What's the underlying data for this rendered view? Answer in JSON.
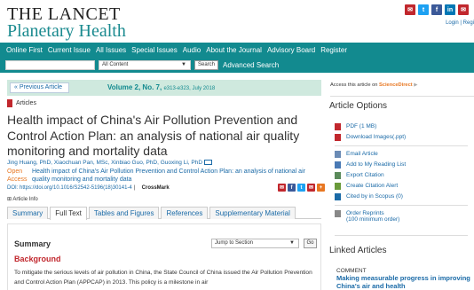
{
  "header": {
    "logo_line1": "THE LANCET",
    "logo_line2": "Planetary Health",
    "social_icons": [
      "email-icon",
      "twitter-icon",
      "facebook-icon",
      "linkedin-icon",
      "mail-icon"
    ],
    "top_links": "Login | Regi"
  },
  "nav": {
    "items": [
      "Online First",
      "Current Issue",
      "All Issues",
      "Special Issues",
      "Audio",
      "About the Journal",
      "Advisory Board",
      "Register"
    ]
  },
  "search": {
    "input_value": "",
    "content_select": "All Content",
    "search_button": "Search",
    "advanced_link": "Advanced Search"
  },
  "issue": {
    "previous_article": "« Previous Article",
    "volume": "Volume 2, No. 7,",
    "volume_detail": "e313-e323, July 2018"
  },
  "article": {
    "section_label": "Articles",
    "title": "Health impact of China's Air Pollution Prevention and Control Action Plan: an analysis of national air quality monitoring and mortality data",
    "authors": "Jing Huang, PhD, Xiaochuan Pan, MSc, Xinbiao Guo, PhD, Guoxing Li, PhD",
    "open_access_label": "Open Access",
    "oa_description": "Health impact of China's Air Pollution Prevention and Control Action Plan: an analysis of national air quality monitoring and mortality data",
    "doi": "DOI: https://doi.org/10.1016/S2542-5196(18)30141-4",
    "doi_dash": "|",
    "crossmark": "CrossMark",
    "article_info": "Article Info",
    "share_icons": [
      "email-icon",
      "facebook-icon",
      "twitter-icon",
      "email-icon",
      "plus-icon"
    ]
  },
  "tabs": [
    "Summary",
    "Full Text",
    "Tables and Figures",
    "References",
    "Supplementary Material"
  ],
  "active_tab": "Full Text",
  "summary": {
    "title": "Summary",
    "jump_select": "Jump to Section",
    "go_button": "Go",
    "background_title": "Background",
    "body_text": "To mitigate the serious levels of air pollution in China, the State Council of China issued the Air Pollution Prevention and Control Action Plan (APPCAP) in 2013. This policy is a milestone in air"
  },
  "sidebar": {
    "access_text": "Access this article on",
    "access_link": "ScienceDirect",
    "access_arrow": "▶",
    "options_title": "Article Options",
    "group1": [
      {
        "label": "PDF (1 MB)",
        "icon": "pdf-icon"
      },
      {
        "label": "Download Images(.ppt)",
        "icon": "image-download-icon"
      }
    ],
    "group2": [
      {
        "label": "Email Article",
        "icon": "email-icon"
      },
      {
        "label": "Add to My Reading List",
        "icon": "reading-list-icon"
      },
      {
        "label": "Export Citation",
        "icon": "export-icon"
      },
      {
        "label": "Create Citation Alert",
        "icon": "alert-icon"
      },
      {
        "label": "Cited by in Scopus (0)",
        "icon": "scopus-icon"
      }
    ],
    "reprints_label": "Order Reprints",
    "reprints_sub": "(100 minimum order)",
    "linked_title": "Linked Articles",
    "comment_label": "COMMENT",
    "comment_title": "Making measurable progress in improving China's air and health"
  },
  "colors": {
    "teal": "#128a8f",
    "link": "#1a6aa7",
    "accent_red": "#c1272d",
    "open_access_orange": "#e87722"
  }
}
